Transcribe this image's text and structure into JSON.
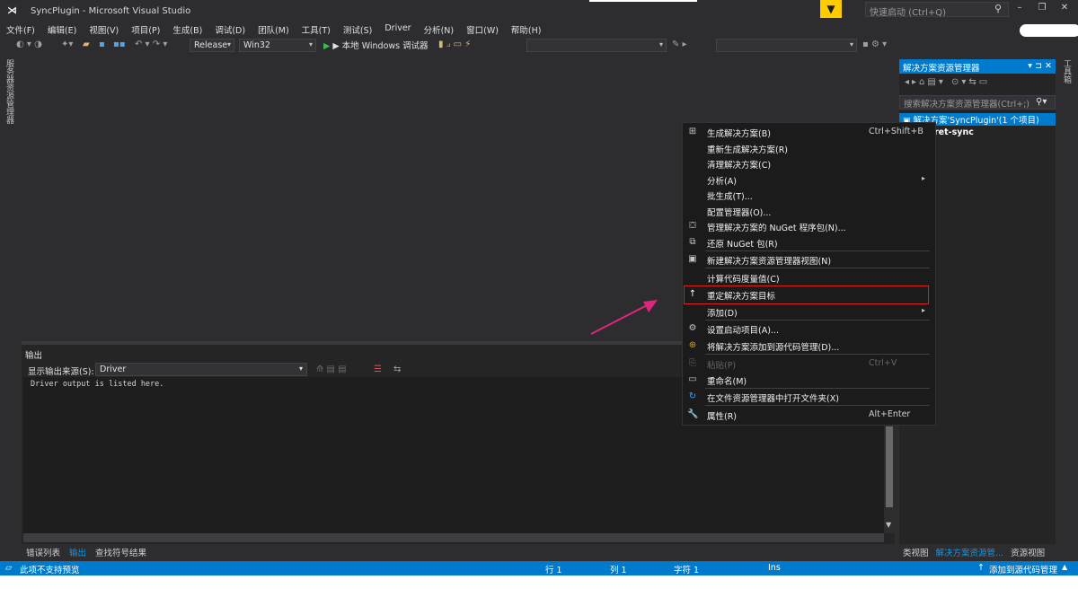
{
  "window": {
    "title": "SyncPlugin - Microsoft Visual Studio",
    "quick_launch_placeholder": "快速启动 (Ctrl+Q)",
    "controls": [
      "–",
      "❐",
      "✕"
    ]
  },
  "menubar": {
    "items": [
      "文件(F)",
      "编辑(E)",
      "视图(V)",
      "项目(P)",
      "生成(B)",
      "调试(D)",
      "团队(M)",
      "工具(T)",
      "测试(S)",
      "Driver",
      "分析(N)",
      "窗口(W)",
      "帮助(H)"
    ]
  },
  "toolbar": {
    "configuration": "Release",
    "platform": "Win32",
    "run_label": "▶ 本地 Windows 调试器"
  },
  "left_rail": {
    "label": "服务器资源管理器"
  },
  "right_rail": {
    "label": "工具箱"
  },
  "output": {
    "title": "输出",
    "source_label": "显示输出来源(S):",
    "source_value": "Driver",
    "text": "Driver output is listed here.",
    "tabs": [
      "错误列表",
      "输出",
      "查找符号结果"
    ],
    "active_tab": "输出"
  },
  "solution_explorer": {
    "title": "解决方案资源管理器",
    "header_icons": "▾ ⊐ ✕",
    "toolbar_icons": "◂▸⌂▤▾ ⊙▾⇆▭",
    "search_placeholder": "搜索解决方案资源管理器(Ctrl+;)",
    "root_item": "解决方案'SyncPlugin'(1 个项目)",
    "project_item": "ret-sync",
    "tabs": [
      "类视图",
      "解决方案资源管...",
      "资源视图"
    ],
    "active_tab": "解决方案资源管..."
  },
  "context_menu": {
    "items": [
      {
        "label": "生成解决方案(B)",
        "shortcut": "Ctrl+Shift+B",
        "icon": "build-icon",
        "glyph": "⊞"
      },
      {
        "label": "重新生成解决方案(R)",
        "shortcut": "",
        "icon": "",
        "glyph": ""
      },
      {
        "label": "清理解决方案(C)",
        "shortcut": "",
        "icon": "",
        "glyph": ""
      },
      {
        "label": "分析(A)",
        "shortcut": "",
        "icon": "",
        "glyph": "",
        "submenu": true
      },
      {
        "label": "批生成(T)...",
        "shortcut": "",
        "icon": "",
        "glyph": ""
      },
      {
        "label": "配置管理器(O)...",
        "shortcut": "",
        "icon": "",
        "glyph": ""
      },
      {
        "label": "管理解决方案的 NuGet 程序包(N)...",
        "shortcut": "",
        "icon": "nuget-icon",
        "glyph": "⛋"
      },
      {
        "label": "还原 NuGet 包(R)",
        "shortcut": "",
        "icon": "restore-icon",
        "glyph": "⧉"
      },
      {
        "label": "新建解决方案资源管理器视图(N)",
        "shortcut": "",
        "icon": "new-view-icon",
        "glyph": "▣"
      },
      {
        "label": "计算代码度量值(C)",
        "shortcut": "",
        "icon": "",
        "glyph": ""
      },
      {
        "label": "重定解决方案目标",
        "shortcut": "",
        "icon": "up-arrow-icon",
        "glyph": "↑"
      },
      {
        "label": "添加(D)",
        "shortcut": "",
        "icon": "",
        "glyph": "",
        "submenu": true
      },
      {
        "label": "设置启动项目(A)...",
        "shortcut": "",
        "icon": "gear-icon",
        "glyph": "⚙"
      },
      {
        "label": "将解决方案添加到源代码管理(D)...",
        "shortcut": "",
        "icon": "source-control-icon",
        "glyph": "⊕"
      },
      {
        "label": "粘贴(P)",
        "shortcut": "Ctrl+V",
        "icon": "paste-icon",
        "glyph": "⎘",
        "disabled": true
      },
      {
        "label": "重命名(M)",
        "shortcut": "",
        "icon": "rename-icon",
        "glyph": "▭"
      },
      {
        "label": "在文件资源管理器中打开文件夹(X)",
        "shortcut": "",
        "icon": "refresh-folder-icon",
        "glyph": "↻"
      },
      {
        "label": "属性(R)",
        "shortcut": "Alt+Enter",
        "icon": "wrench-icon",
        "glyph": "🔧"
      }
    ]
  },
  "statusbar": {
    "message": "此项不支持预览",
    "line": "行 1",
    "col": "列 1",
    "char": "字符 1",
    "mode": "Ins",
    "source_control": "添加到源代码管理"
  },
  "colors": {
    "accent": "#007acc",
    "highlight_box": "#e02020",
    "annotation_arrow": "#e0257f"
  }
}
